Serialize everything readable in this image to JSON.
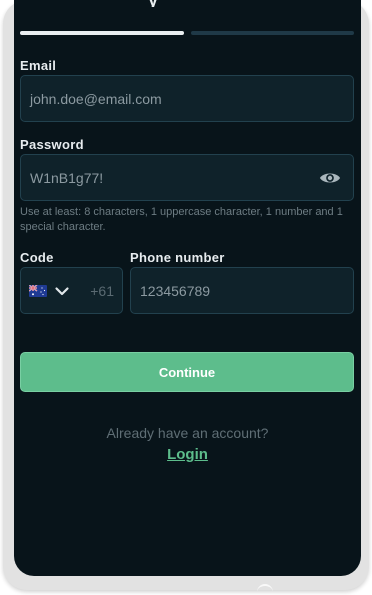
{
  "form": {
    "email": {
      "label": "Email",
      "value": "john.doe@email.com"
    },
    "password": {
      "label": "Password",
      "value": "W1nB1g77!",
      "hint": "Use at least: 8 characters, 1 uppercase character, 1 number and 1 special character.",
      "toggle_icon": "eye-icon"
    },
    "code": {
      "label": "Code",
      "flag_icon": "australia-flag-icon",
      "dial_code": "+61"
    },
    "phone": {
      "label": "Phone number",
      "value": "123456789"
    },
    "continue_label": "Continue"
  },
  "footer": {
    "prompt": "Already have an account?",
    "login_label": "Login"
  },
  "progress": {
    "steps_total": 2,
    "current_step": 1
  },
  "colors": {
    "background": "#08141a",
    "field": "#0f222a",
    "accent": "#5dbd8c",
    "progress_active": "#e9eef1",
    "progress_inactive": "#1f3947"
  }
}
